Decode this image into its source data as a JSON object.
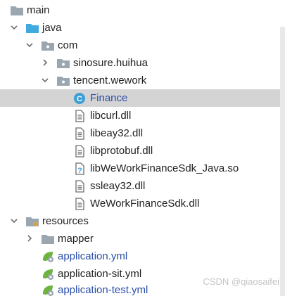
{
  "tree": {
    "items": [
      {
        "label": "main",
        "icon": "folder-icon",
        "expanded": true
      },
      {
        "label": "java",
        "icon": "source-folder-icon",
        "expanded": true
      },
      {
        "label": "com",
        "icon": "package-icon",
        "expanded": true
      },
      {
        "label": "sinosure.huihua",
        "icon": "package-icon",
        "expanded": false
      },
      {
        "label": "tencent.wework",
        "icon": "package-icon",
        "expanded": true
      },
      {
        "label": "Finance",
        "icon": "java-class-icon",
        "selected": true
      },
      {
        "label": "libcurl.dll",
        "icon": "file-icon"
      },
      {
        "label": "libeay32.dll",
        "icon": "file-icon"
      },
      {
        "label": "libprotobuf.dll",
        "icon": "file-icon"
      },
      {
        "label": "libWeWorkFinanceSdk_Java.so",
        "icon": "unknown-file-icon"
      },
      {
        "label": "ssleay32.dll",
        "icon": "file-icon"
      },
      {
        "label": "WeWorkFinanceSdk.dll",
        "icon": "file-icon"
      },
      {
        "label": "resources",
        "icon": "resources-folder-icon",
        "expanded": true
      },
      {
        "label": "mapper",
        "icon": "folder-icon",
        "expanded": false
      },
      {
        "label": "application.yml",
        "icon": "spring-config-icon"
      },
      {
        "label": "application-sit.yml",
        "icon": "spring-config-icon"
      },
      {
        "label": "application-test.yml",
        "icon": "spring-config-icon"
      }
    ]
  },
  "watermark": "CSDN @qiaosaifei",
  "colors": {
    "selection": "#d4d4d4",
    "folder": "#9aa7b0",
    "source_folder": "#40a9de",
    "class_icon": "#3d9fd6",
    "spring_icon": "#6db33f",
    "modified_text": "#2a4ea8"
  }
}
